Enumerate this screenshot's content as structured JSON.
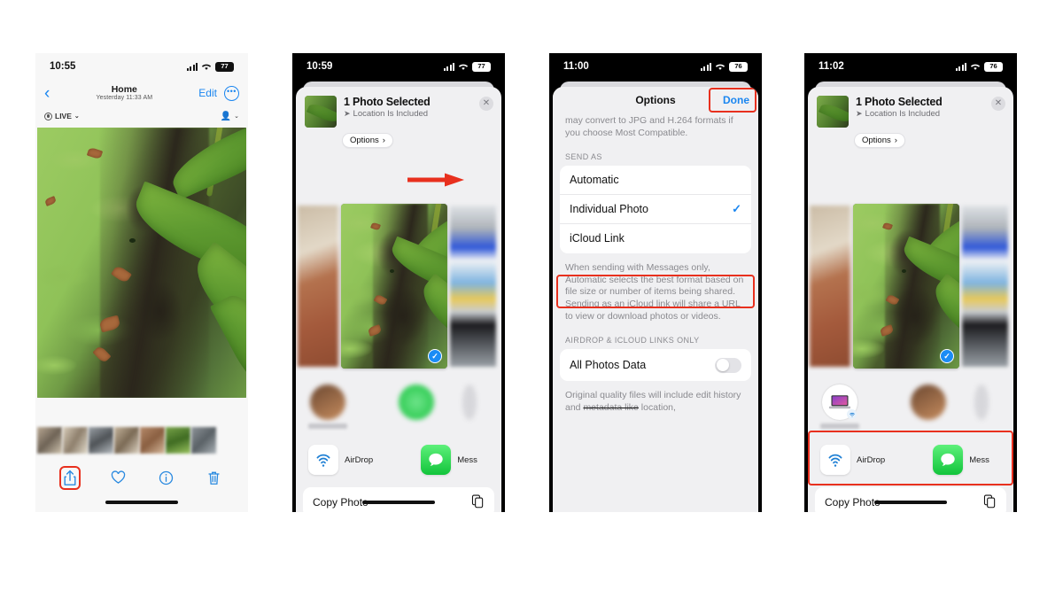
{
  "panels": {
    "p1": {
      "status": {
        "time": "10:55",
        "battery": "77"
      },
      "nav": {
        "back": "‹",
        "title": "Home",
        "subtitle": "Yesterday  11:33 AM",
        "edit": "Edit",
        "more": "•••"
      },
      "subbar": {
        "live": "LIVE",
        "live_chevron": "⌄",
        "people_chevron": "⌄"
      },
      "toolbar": {
        "share": "share-icon",
        "favorite": "heart-icon",
        "info": "info-icon",
        "delete": "trash-icon"
      }
    },
    "p2": {
      "status": {
        "time": "10:59",
        "battery": "77"
      },
      "sheet": {
        "title": "1 Photo Selected",
        "subtitle": "Location Is Included",
        "options_label": "Options",
        "options_chevron": "›",
        "close": "✕"
      },
      "apps": [
        {
          "label": "AirDrop",
          "icon": "airdrop-icon"
        },
        {
          "label": "Mess",
          "icon": "messages-icon"
        }
      ],
      "action": {
        "label": "Copy Photo",
        "icon": "copy-icon"
      }
    },
    "p3": {
      "status": {
        "time": "11:00",
        "battery": "76"
      },
      "header": {
        "title": "Options",
        "done": "Done"
      },
      "note_top": "may convert to JPG and H.264 formats if you choose Most Compatible.",
      "send_as_label": "SEND AS",
      "send_as_options": [
        {
          "label": "Automatic",
          "checked": false
        },
        {
          "label": "Individual Photo",
          "checked": true
        },
        {
          "label": "iCloud Link",
          "checked": false
        }
      ],
      "send_as_note": "When sending with Messages only, Automatic selects the best format based on file size or number of items being shared. Sending as an iCloud link will share a URL to view or download photos or videos.",
      "airdrop_label": "AIRDROP & ICLOUD LINKS ONLY",
      "all_photos_data": {
        "label": "All Photos Data",
        "on": false
      },
      "note_bottom_a": "Original quality files will include edit",
      "note_bottom_b": "history and ",
      "note_bottom_strike": "metadata like",
      "note_bottom_c": " location,"
    },
    "p4": {
      "status": {
        "time": "11:02",
        "battery": "76"
      },
      "sheet": {
        "title": "1 Photo Selected",
        "subtitle": "Location Is Included",
        "options_label": "Options",
        "options_chevron": "›",
        "close": "✕"
      },
      "apps": [
        {
          "label": "AirDrop",
          "icon": "airdrop-icon"
        },
        {
          "label": "Mess",
          "icon": "messages-icon"
        }
      ],
      "action": {
        "label": "Copy Photo",
        "icon": "copy-icon"
      }
    }
  },
  "colors": {
    "accent_blue": "#1a86f0",
    "highlight_red": "#e8301e",
    "messages_green": "#12c43b",
    "sheet_bg": "#f0f0f2"
  }
}
